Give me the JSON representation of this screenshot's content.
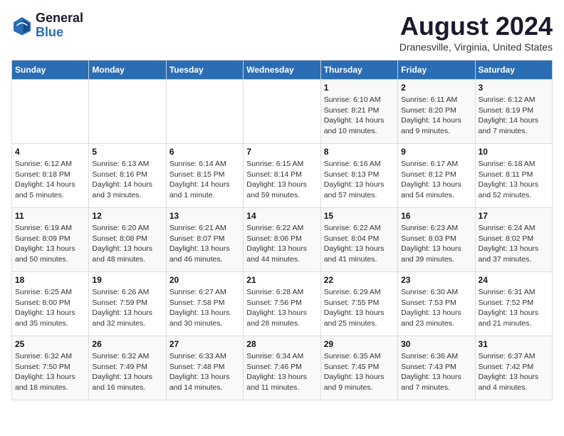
{
  "header": {
    "logo_line1": "General",
    "logo_line2": "Blue",
    "main_title": "August 2024",
    "subtitle": "Dranesville, Virginia, United States"
  },
  "days_of_week": [
    "Sunday",
    "Monday",
    "Tuesday",
    "Wednesday",
    "Thursday",
    "Friday",
    "Saturday"
  ],
  "weeks": [
    [
      {
        "day": "",
        "info": ""
      },
      {
        "day": "",
        "info": ""
      },
      {
        "day": "",
        "info": ""
      },
      {
        "day": "",
        "info": ""
      },
      {
        "day": "1",
        "info": "Sunrise: 6:10 AM\nSunset: 8:21 PM\nDaylight: 14 hours\nand 10 minutes."
      },
      {
        "day": "2",
        "info": "Sunrise: 6:11 AM\nSunset: 8:20 PM\nDaylight: 14 hours\nand 9 minutes."
      },
      {
        "day": "3",
        "info": "Sunrise: 6:12 AM\nSunset: 8:19 PM\nDaylight: 14 hours\nand 7 minutes."
      }
    ],
    [
      {
        "day": "4",
        "info": "Sunrise: 6:12 AM\nSunset: 8:18 PM\nDaylight: 14 hours\nand 5 minutes."
      },
      {
        "day": "5",
        "info": "Sunrise: 6:13 AM\nSunset: 8:16 PM\nDaylight: 14 hours\nand 3 minutes."
      },
      {
        "day": "6",
        "info": "Sunrise: 6:14 AM\nSunset: 8:15 PM\nDaylight: 14 hours\nand 1 minute."
      },
      {
        "day": "7",
        "info": "Sunrise: 6:15 AM\nSunset: 8:14 PM\nDaylight: 13 hours\nand 59 minutes."
      },
      {
        "day": "8",
        "info": "Sunrise: 6:16 AM\nSunset: 8:13 PM\nDaylight: 13 hours\nand 57 minutes."
      },
      {
        "day": "9",
        "info": "Sunrise: 6:17 AM\nSunset: 8:12 PM\nDaylight: 13 hours\nand 54 minutes."
      },
      {
        "day": "10",
        "info": "Sunrise: 6:18 AM\nSunset: 8:11 PM\nDaylight: 13 hours\nand 52 minutes."
      }
    ],
    [
      {
        "day": "11",
        "info": "Sunrise: 6:19 AM\nSunset: 8:09 PM\nDaylight: 13 hours\nand 50 minutes."
      },
      {
        "day": "12",
        "info": "Sunrise: 6:20 AM\nSunset: 8:08 PM\nDaylight: 13 hours\nand 48 minutes."
      },
      {
        "day": "13",
        "info": "Sunrise: 6:21 AM\nSunset: 8:07 PM\nDaylight: 13 hours\nand 46 minutes."
      },
      {
        "day": "14",
        "info": "Sunrise: 6:22 AM\nSunset: 8:06 PM\nDaylight: 13 hours\nand 44 minutes."
      },
      {
        "day": "15",
        "info": "Sunrise: 6:22 AM\nSunset: 8:04 PM\nDaylight: 13 hours\nand 41 minutes."
      },
      {
        "day": "16",
        "info": "Sunrise: 6:23 AM\nSunset: 8:03 PM\nDaylight: 13 hours\nand 39 minutes."
      },
      {
        "day": "17",
        "info": "Sunrise: 6:24 AM\nSunset: 8:02 PM\nDaylight: 13 hours\nand 37 minutes."
      }
    ],
    [
      {
        "day": "18",
        "info": "Sunrise: 6:25 AM\nSunset: 8:00 PM\nDaylight: 13 hours\nand 35 minutes."
      },
      {
        "day": "19",
        "info": "Sunrise: 6:26 AM\nSunset: 7:59 PM\nDaylight: 13 hours\nand 32 minutes."
      },
      {
        "day": "20",
        "info": "Sunrise: 6:27 AM\nSunset: 7:58 PM\nDaylight: 13 hours\nand 30 minutes."
      },
      {
        "day": "21",
        "info": "Sunrise: 6:28 AM\nSunset: 7:56 PM\nDaylight: 13 hours\nand 28 minutes."
      },
      {
        "day": "22",
        "info": "Sunrise: 6:29 AM\nSunset: 7:55 PM\nDaylight: 13 hours\nand 25 minutes."
      },
      {
        "day": "23",
        "info": "Sunrise: 6:30 AM\nSunset: 7:53 PM\nDaylight: 13 hours\nand 23 minutes."
      },
      {
        "day": "24",
        "info": "Sunrise: 6:31 AM\nSunset: 7:52 PM\nDaylight: 13 hours\nand 21 minutes."
      }
    ],
    [
      {
        "day": "25",
        "info": "Sunrise: 6:32 AM\nSunset: 7:50 PM\nDaylight: 13 hours\nand 18 minutes."
      },
      {
        "day": "26",
        "info": "Sunrise: 6:32 AM\nSunset: 7:49 PM\nDaylight: 13 hours\nand 16 minutes."
      },
      {
        "day": "27",
        "info": "Sunrise: 6:33 AM\nSunset: 7:48 PM\nDaylight: 13 hours\nand 14 minutes."
      },
      {
        "day": "28",
        "info": "Sunrise: 6:34 AM\nSunset: 7:46 PM\nDaylight: 13 hours\nand 11 minutes."
      },
      {
        "day": "29",
        "info": "Sunrise: 6:35 AM\nSunset: 7:45 PM\nDaylight: 13 hours\nand 9 minutes."
      },
      {
        "day": "30",
        "info": "Sunrise: 6:36 AM\nSunset: 7:43 PM\nDaylight: 13 hours\nand 7 minutes."
      },
      {
        "day": "31",
        "info": "Sunrise: 6:37 AM\nSunset: 7:42 PM\nDaylight: 13 hours\nand 4 minutes."
      }
    ]
  ]
}
